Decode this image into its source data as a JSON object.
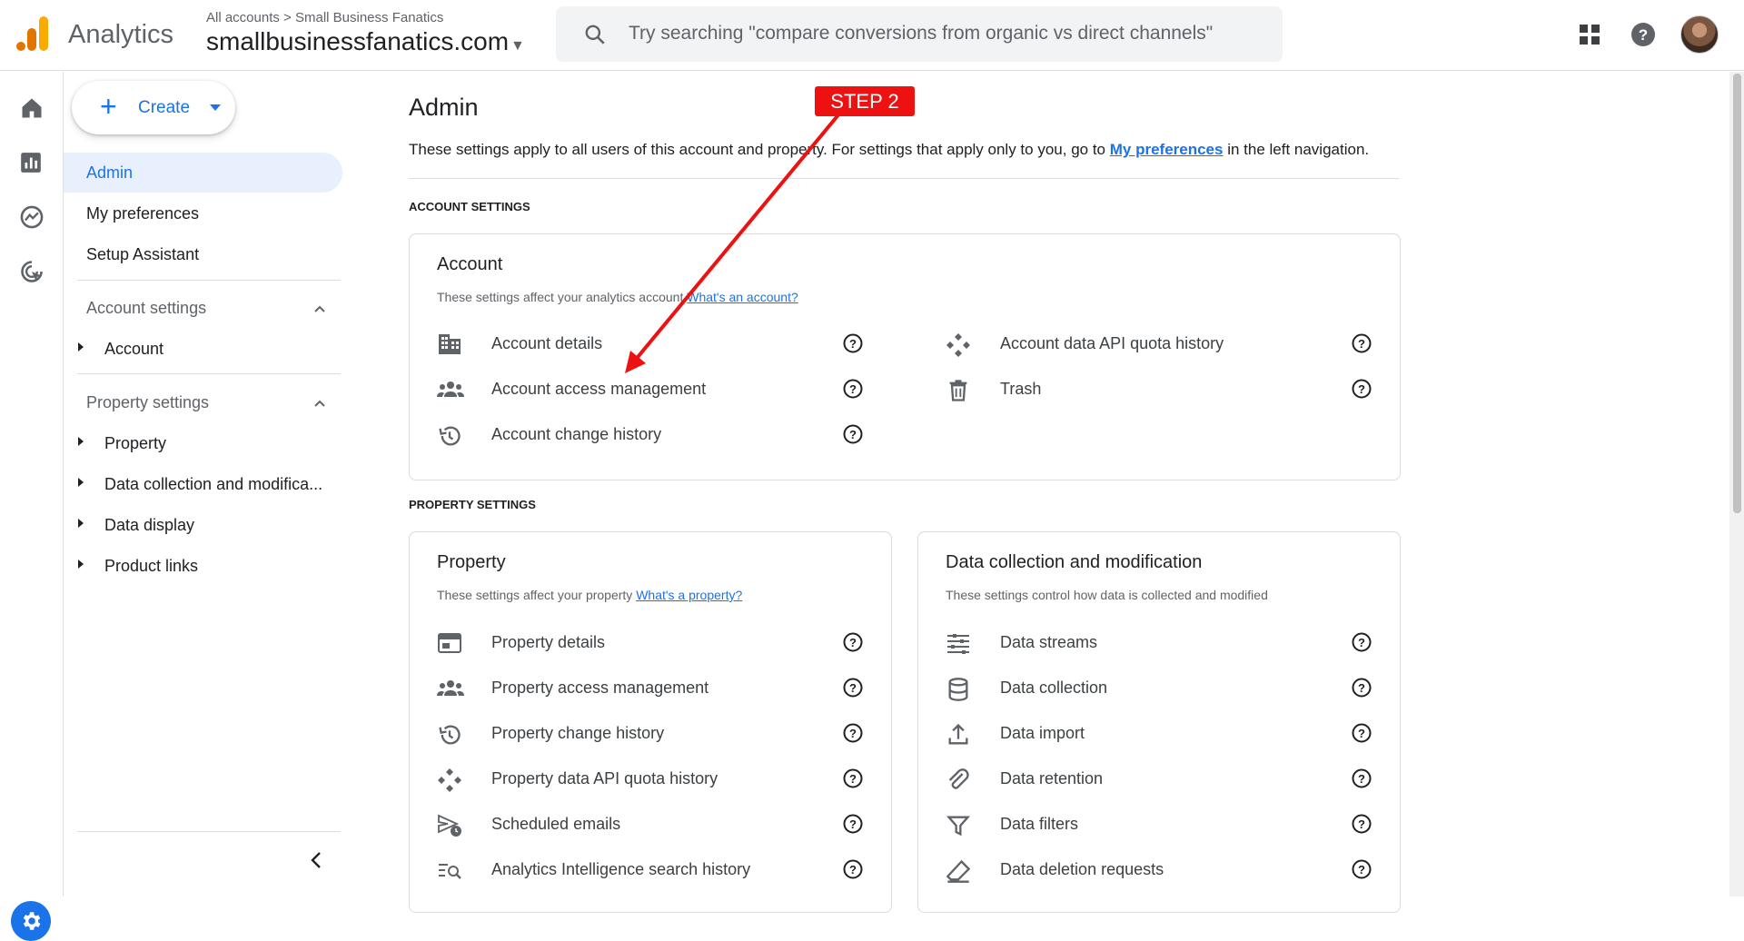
{
  "topbar": {
    "brand": "Analytics",
    "breadcrumb_accounts": "All accounts",
    "breadcrumb_account": "Small Business Fanatics",
    "property": "smallbusinessfanatics.com",
    "search_placeholder": "Try searching \"compare conversions from organic vs direct channels\"",
    "icons": [
      "apps-grid-icon",
      "help-icon",
      "avatar"
    ]
  },
  "rail": {
    "icons": [
      "home-icon",
      "reports-icon",
      "explore-icon",
      "advertising-icon",
      "admin-gear-icon"
    ]
  },
  "nav": {
    "create": "Create",
    "items": [
      "Admin",
      "My preferences",
      "Setup Assistant"
    ],
    "account_settings": {
      "label": "Account settings",
      "children": [
        "Account"
      ]
    },
    "property_settings": {
      "label": "Property settings",
      "children": [
        "Property",
        "Data collection and modifica...",
        "Data display",
        "Product links"
      ]
    }
  },
  "main": {
    "title": "Admin",
    "description_pre": "These settings apply to all users of this account and property. For settings that apply only to you, go to ",
    "description_link": "My preferences",
    "description_post": " in the left navigation.",
    "account_section_label": "ACCOUNT SETTINGS",
    "property_section_label": "PROPERTY SETTINGS",
    "account_card": {
      "title": "Account",
      "subtitle": "These settings affect your analytics account ",
      "subtitle_link": "What's an account?",
      "left": [
        "Account details",
        "Account access management",
        "Account change history"
      ],
      "right": [
        "Account data API quota history",
        "Trash"
      ]
    },
    "property_card": {
      "title": "Property",
      "subtitle": "These settings affect your property ",
      "subtitle_link": "What's a property?",
      "items": [
        "Property details",
        "Property access management",
        "Property change history",
        "Property data API quota history",
        "Scheduled emails",
        "Analytics Intelligence search history"
      ]
    },
    "data_card": {
      "title": "Data collection and modification",
      "subtitle": "These settings control how data is collected and modified",
      "items": [
        "Data streams",
        "Data collection",
        "Data import",
        "Data retention",
        "Data filters",
        "Data deletion requests"
      ]
    }
  },
  "annotation": {
    "label": "STEP 2",
    "color": "#ee1111"
  },
  "colors": {
    "accent": "#1a73e8",
    "selected_bg": "#e8f0fe"
  }
}
